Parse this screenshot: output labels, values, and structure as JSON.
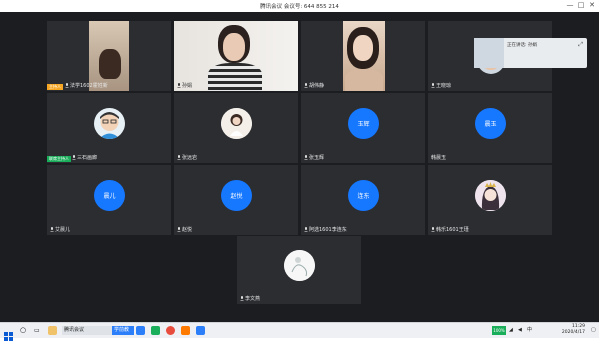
{
  "window": {
    "title": "腾讯会议 会议号: 644 855 214",
    "controls": [
      "—",
      "□",
      "✕"
    ]
  },
  "tiles": [
    {
      "name": "法学1602霍姓新",
      "tag": "主持人",
      "tag_color": "#f5a623",
      "kind": "video"
    },
    {
      "name": "孙娟",
      "kind": "video"
    },
    {
      "name": "胡伟静",
      "kind": "video"
    },
    {
      "name": "王晓琼",
      "kind": "video"
    },
    {
      "name": "三石画廊",
      "tag": "联席主持人",
      "tag_color": "#1aad5a",
      "kind": "avatar-img"
    },
    {
      "name": "张远岩",
      "kind": "avatar-img"
    },
    {
      "name": "张玉辉",
      "kind": "avatar",
      "avatar_text": "玉辉"
    },
    {
      "name": "韩晨玉",
      "kind": "avatar",
      "avatar_text": "晨玉"
    },
    {
      "name": "艾晨儿",
      "kind": "avatar",
      "avatar_text": "晨儿"
    },
    {
      "name": "赵悦",
      "kind": "avatar",
      "avatar_text": "赵悦"
    },
    {
      "name": "阿选1601李连东",
      "kind": "avatar",
      "avatar_text": "连东"
    },
    {
      "name": "韩乐1601王瑾",
      "kind": "avatar-img"
    },
    {
      "name": "李文燕",
      "kind": "avatar-img"
    }
  ],
  "mini_panel": {
    "label": "正在讲话: 孙娟"
  },
  "taskbar": {
    "search_placeholder": "",
    "active_app": "腾讯会议",
    "app_label_2": "学前教育-1",
    "time": "11:29",
    "date": "2020/4/17",
    "ime": "中",
    "tray": "100%"
  },
  "colors": {
    "accent": "#1677ff",
    "stage": "#1b1d21",
    "tile": "#2b2d31"
  }
}
